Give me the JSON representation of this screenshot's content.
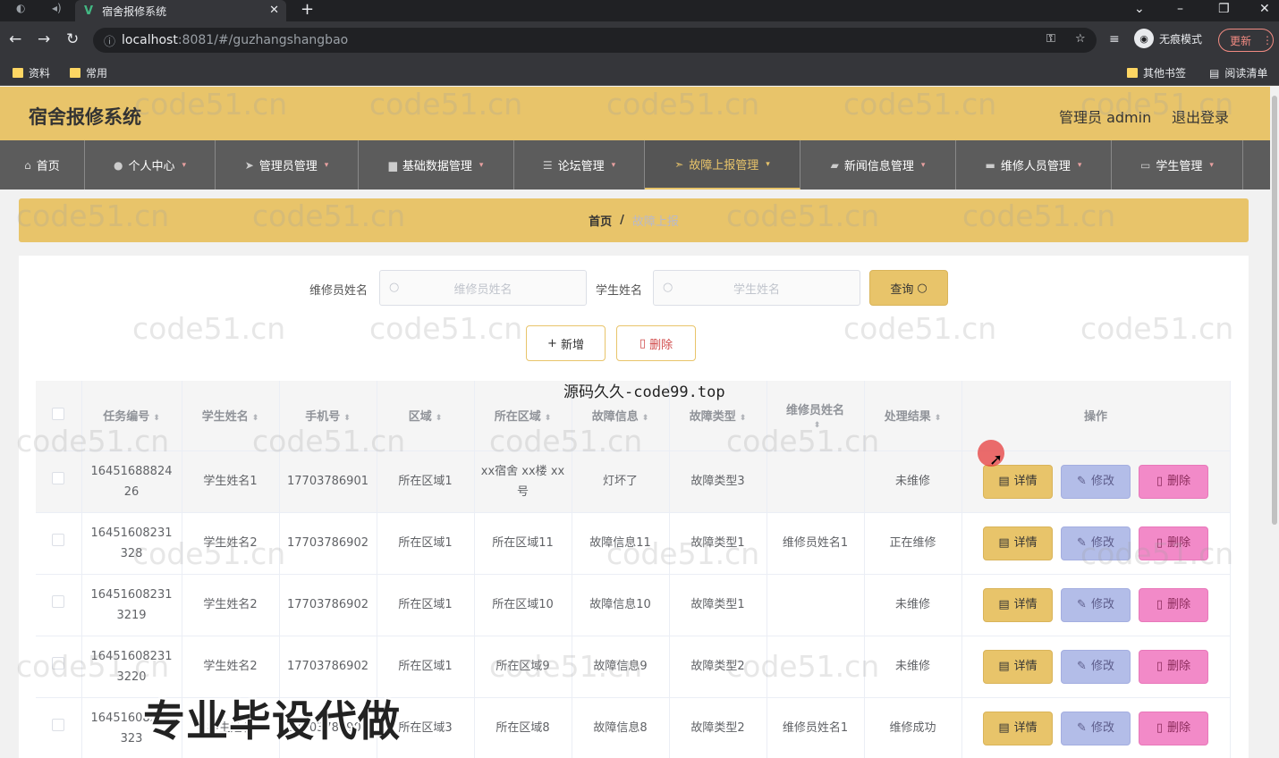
{
  "browser": {
    "tab_title": "宿舍报修系统",
    "url_host": "localhost",
    "url_rest": ":8081/#/guzhangshangbao",
    "incognito_label": "无痕模式",
    "update_label": "更新",
    "bookmarks": [
      "资料",
      "常用"
    ],
    "bookmarks_right": [
      "其他书签",
      "阅读清单"
    ]
  },
  "header": {
    "title": "宿舍报修系统",
    "user": "管理员 admin",
    "logout": "退出登录"
  },
  "nav": {
    "items": [
      {
        "label": "首页",
        "icon": "home-icon"
      },
      {
        "label": "个人中心",
        "icon": "user-icon"
      },
      {
        "label": "管理员管理",
        "icon": "send-icon"
      },
      {
        "label": "基础数据管理",
        "icon": "cup-icon"
      },
      {
        "label": "论坛管理",
        "icon": "sliders-icon"
      },
      {
        "label": "故障上报管理",
        "icon": "send-icon"
      },
      {
        "label": "新闻信息管理",
        "icon": "camera-icon"
      },
      {
        "label": "维修人员管理",
        "icon": "monitor-icon"
      },
      {
        "label": "学生管理",
        "icon": "chat-icon"
      }
    ],
    "active_index": 5
  },
  "breadcrumb": {
    "home": "首页",
    "separator": "/",
    "current": "故障上报"
  },
  "search": {
    "repair_label": "维修员姓名",
    "repair_placeholder": "维修员姓名",
    "student_label": "学生姓名",
    "student_placeholder": "学生姓名",
    "query_label": "查询"
  },
  "actions": {
    "add_label": "新增",
    "delete_label": "删除"
  },
  "table": {
    "headers": [
      "任务编号",
      "学生姓名",
      "手机号",
      "区域",
      "所在区域",
      "故障信息",
      "故障类型",
      "维修员姓名",
      "处理结果",
      "操作"
    ],
    "row_buttons": {
      "detail": "详情",
      "edit": "修改",
      "delete": "删除"
    },
    "rows": [
      [
        "1645168882426",
        "学生姓名1",
        "17703786901",
        "所在区域1",
        "xx宿舍 xx楼 xx号",
        "灯坏了",
        "故障类型3",
        "",
        "未维修"
      ],
      [
        "16451608231328",
        "学生姓名2",
        "17703786902",
        "所在区域1",
        "所在区域11",
        "故障信息11",
        "故障类型1",
        "维修员姓名1",
        "正在维修"
      ],
      [
        "164516082313219",
        "学生姓名2",
        "17703786902",
        "所在区域1",
        "所在区域10",
        "故障信息10",
        "故障类型1",
        "",
        "未维修"
      ],
      [
        "164516082313220",
        "学生姓名2",
        "17703786902",
        "所在区域1",
        "所在区域9",
        "故障信息9",
        "故障类型2",
        "",
        "未维修"
      ],
      [
        "16451608231323",
        "学生姓名",
        "17703786901",
        "所在区域3",
        "所在区域8",
        "故障信息8",
        "故障类型2",
        "维修员姓名1",
        "维修成功"
      ]
    ]
  },
  "overlays": {
    "code_text": "源码久久-code99.top",
    "ad_text": "专业毕设代做",
    "watermark": "code51.cn"
  }
}
